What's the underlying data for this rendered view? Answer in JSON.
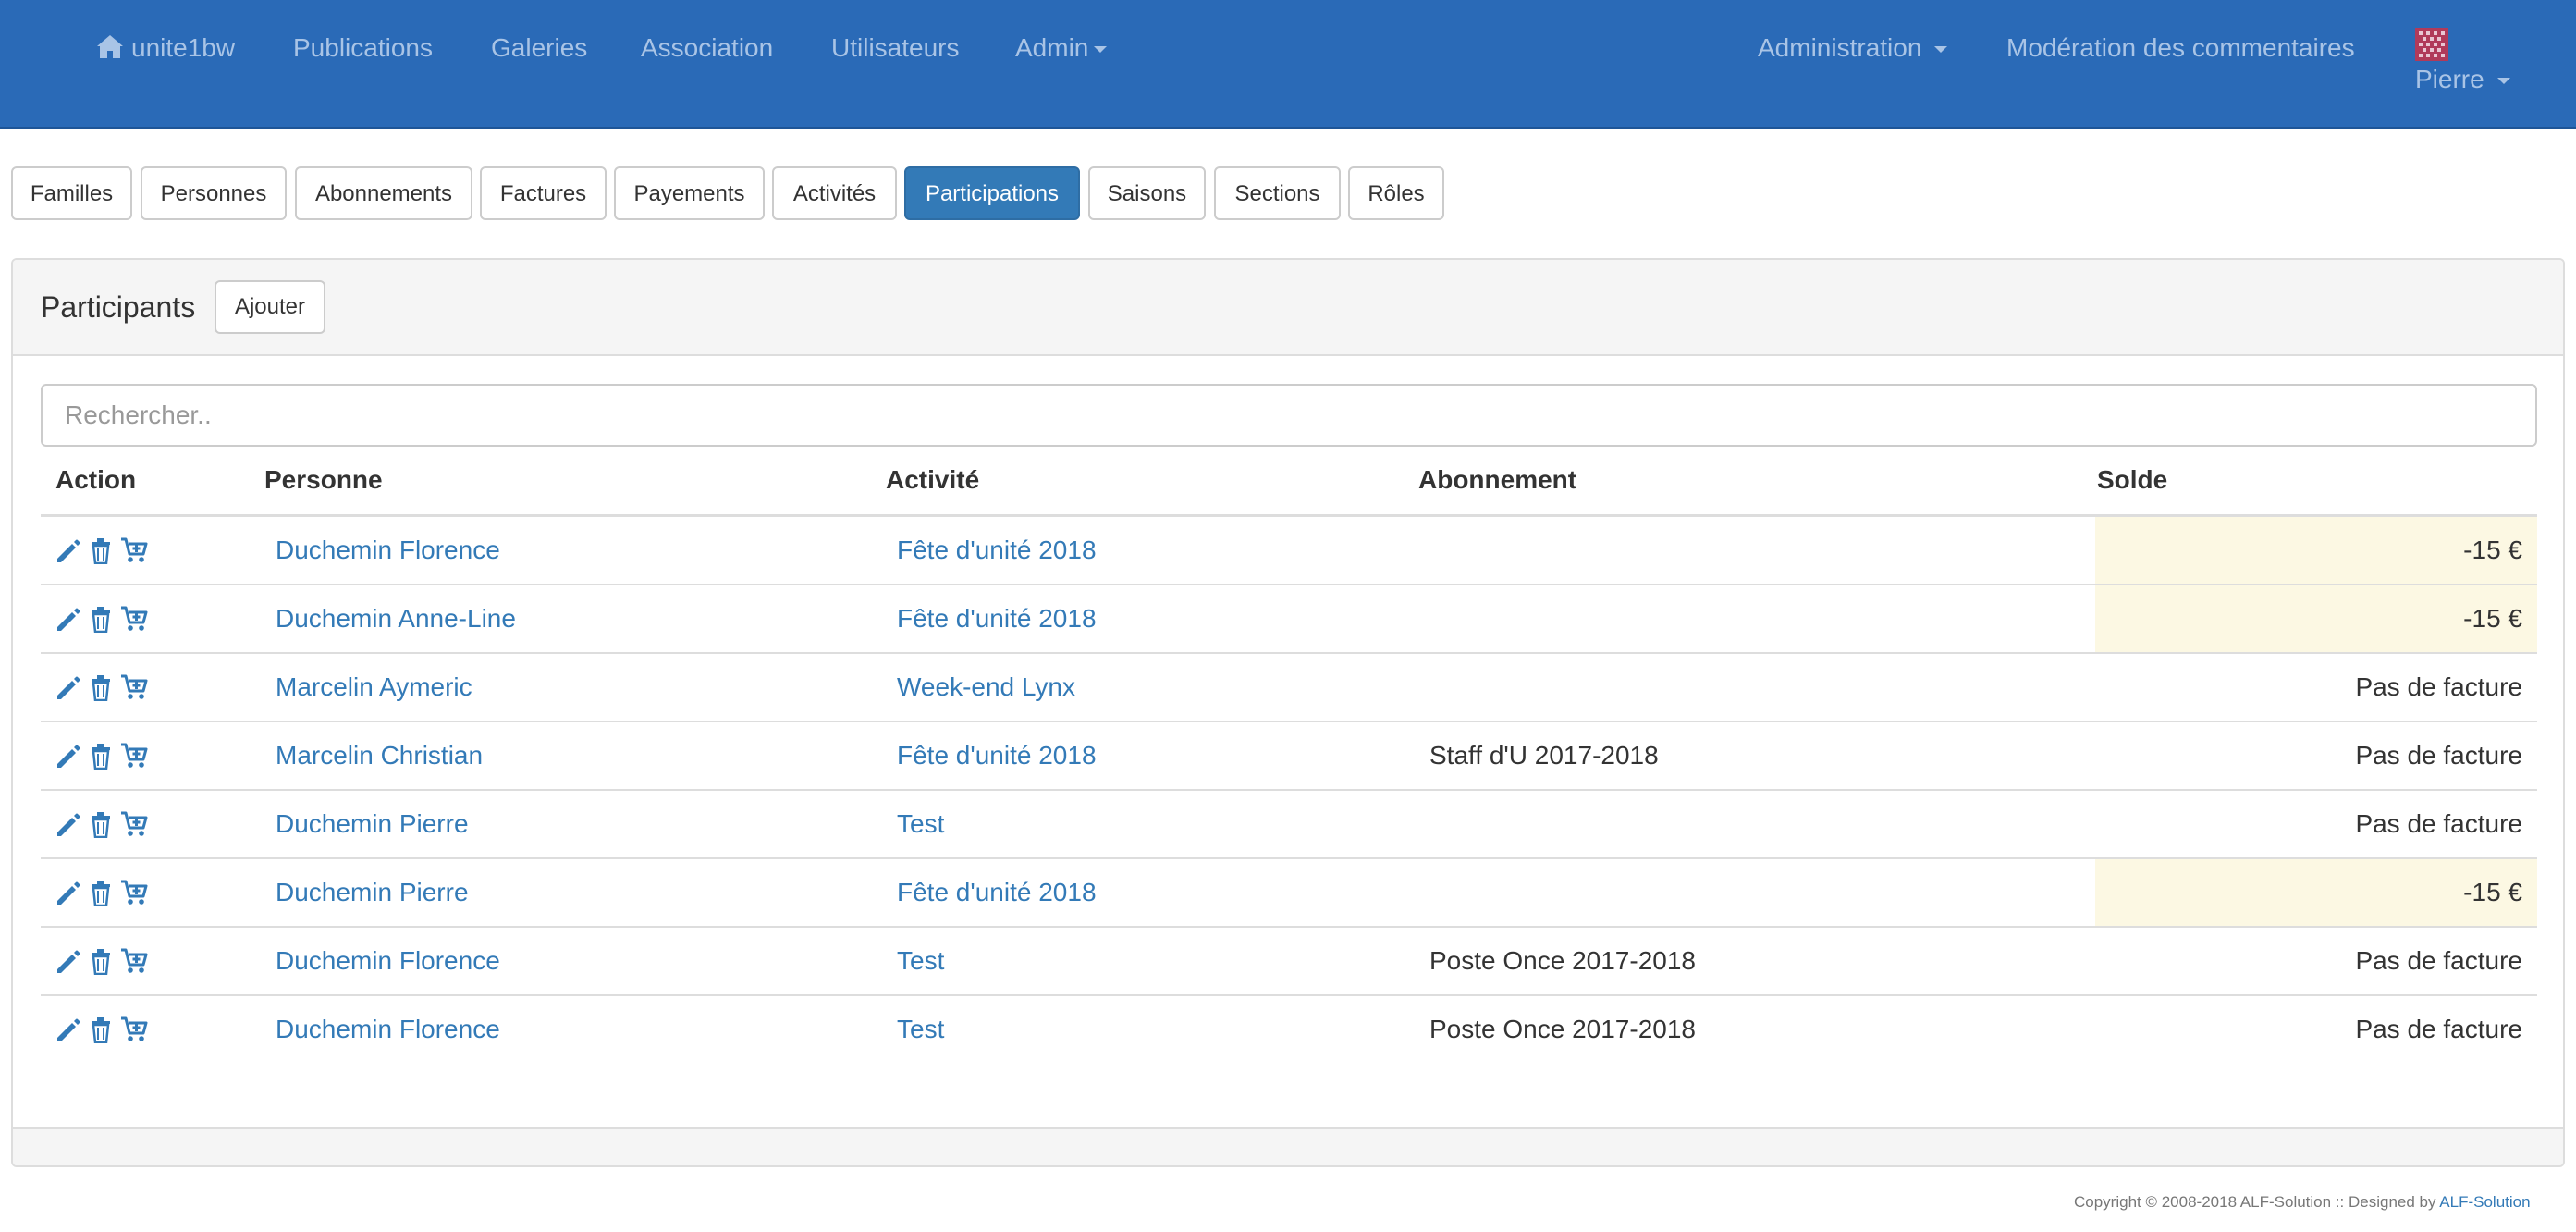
{
  "navbar": {
    "brand": "unite1bw",
    "items": [
      {
        "label": "Publications"
      },
      {
        "label": "Galeries"
      },
      {
        "label": "Association"
      },
      {
        "label": "Utilisateurs"
      },
      {
        "label": "Admin"
      }
    ],
    "right_items": [
      {
        "label": "Administration"
      },
      {
        "label": "Modération des commentaires"
      }
    ],
    "user": "Pierre",
    "color": "#2a6ab7",
    "link_color": "#a9c4e6"
  },
  "tabs": [
    {
      "label": "Familles"
    },
    {
      "label": "Personnes"
    },
    {
      "label": "Abonnements"
    },
    {
      "label": "Factures"
    },
    {
      "label": "Payements"
    },
    {
      "label": "Activités"
    },
    {
      "label": "Participations",
      "active": true
    },
    {
      "label": "Saisons"
    },
    {
      "label": "Sections"
    },
    {
      "label": "Rôles"
    }
  ],
  "panel": {
    "title": "Participants",
    "add_label": "Ajouter",
    "search_placeholder": "Rechercher.."
  },
  "table": {
    "columns": [
      "Action",
      "Personne",
      "Activité",
      "Abonnement",
      "Solde"
    ],
    "action_icons": [
      "pencil-icon",
      "trash-icon",
      "cart-plus-icon"
    ],
    "rows": [
      {
        "personne": "Duchemin Florence",
        "activite": "Fête d'unité 2018",
        "abonnement": "",
        "solde": "-15 €",
        "warning": true
      },
      {
        "personne": "Duchemin Anne-Line",
        "activite": "Fête d'unité 2018",
        "abonnement": "",
        "solde": "-15 €",
        "warning": true
      },
      {
        "personne": "Marcelin Aymeric",
        "activite": "Week-end Lynx",
        "abonnement": "",
        "solde": "Pas de facture",
        "warning": false
      },
      {
        "personne": "Marcelin Christian",
        "activite": "Fête d'unité 2018",
        "abonnement": "Staff d'U 2017-2018",
        "solde": "Pas de facture",
        "warning": false
      },
      {
        "personne": "Duchemin Pierre",
        "activite": "Test",
        "abonnement": "",
        "solde": "Pas de facture",
        "warning": false
      },
      {
        "personne": "Duchemin Pierre",
        "activite": "Fête d'unité 2018",
        "abonnement": "",
        "solde": "-15 €",
        "warning": true
      },
      {
        "personne": "Duchemin Florence",
        "activite": "Test",
        "abonnement": "Poste Once 2017-2018",
        "solde": "Pas de facture",
        "warning": false
      },
      {
        "personne": "Duchemin Florence",
        "activite": "Test",
        "abonnement": "Poste Once 2017-2018",
        "solde": "Pas de facture",
        "warning": false
      }
    ]
  },
  "footer": {
    "copyright": "Copyright © 2008-2018 ALF-Solution :: Designed by",
    "designer_link": "ALF-Solution"
  },
  "colors": {
    "primary": "#337ab7",
    "warning_bg": "#fcf8e3"
  }
}
